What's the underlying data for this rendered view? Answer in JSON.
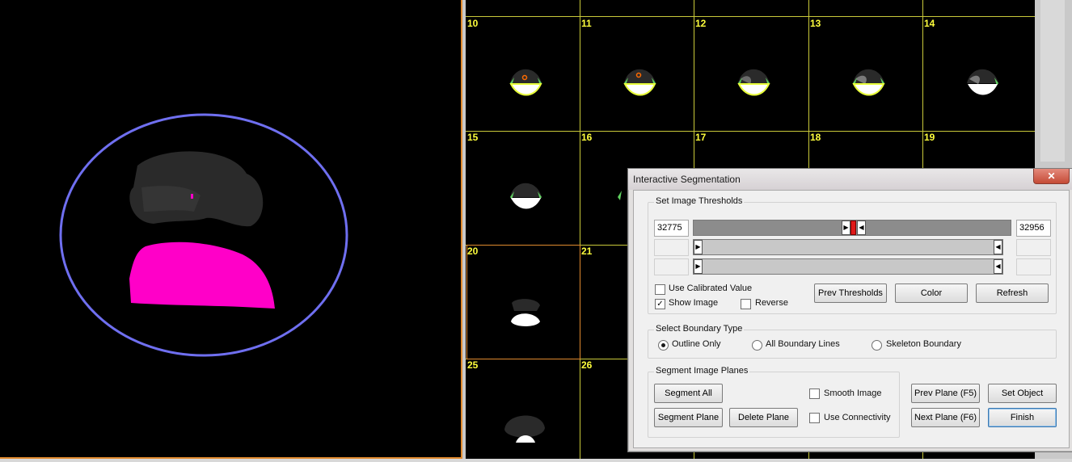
{
  "viewer": {
    "cells": [
      {
        "label": "10"
      },
      {
        "label": "11"
      },
      {
        "label": "12"
      },
      {
        "label": "13"
      },
      {
        "label": "14"
      },
      {
        "label": "15"
      },
      {
        "label": "16"
      },
      {
        "label": "17"
      },
      {
        "label": "18"
      },
      {
        "label": "19"
      },
      {
        "label": "20"
      },
      {
        "label": "21"
      },
      {
        "label": "25"
      },
      {
        "label": "26"
      }
    ],
    "selected_cell": "20",
    "colors": {
      "roi_circle": "#6f6ff0",
      "segmented_region": "#ff00c8",
      "grid_line": "#c9c93a",
      "cell_label": "#ffff3c",
      "selection": "#e08a2e"
    }
  },
  "dialog": {
    "title": "Interactive Segmentation",
    "close_icon": "close-icon",
    "thresholds": {
      "legend": "Set Image Thresholds",
      "low_value": "32775",
      "high_value": "32956",
      "slider_level": 0.5,
      "use_calibrated_label": "Use Calibrated Value",
      "use_calibrated_checked": false,
      "show_image_label": "Show Image",
      "show_image_checked": true,
      "reverse_label": "Reverse",
      "reverse_checked": false,
      "prev_thresholds_label": "Prev Thresholds",
      "color_label": "Color",
      "refresh_label": "Refresh"
    },
    "boundary": {
      "legend": "Select Boundary Type",
      "options": [
        {
          "label": "Outline Only",
          "selected": true
        },
        {
          "label": "All Boundary Lines",
          "selected": false
        },
        {
          "label": "Skeleton Boundary",
          "selected": false
        }
      ]
    },
    "segment": {
      "legend": "Segment Image Planes",
      "segment_all_label": "Segment All",
      "segment_plane_label": "Segment Plane",
      "delete_plane_label": "Delete Plane",
      "smooth_image_label": "Smooth Image",
      "smooth_image_checked": false,
      "use_connectivity_label": "Use Connectivity",
      "use_connectivity_checked": false
    },
    "nav": {
      "prev_plane_label": "Prev Plane (F5)",
      "next_plane_label": "Next Plane (F6)",
      "set_object_label": "Set Object",
      "finish_label": "Finish"
    }
  }
}
